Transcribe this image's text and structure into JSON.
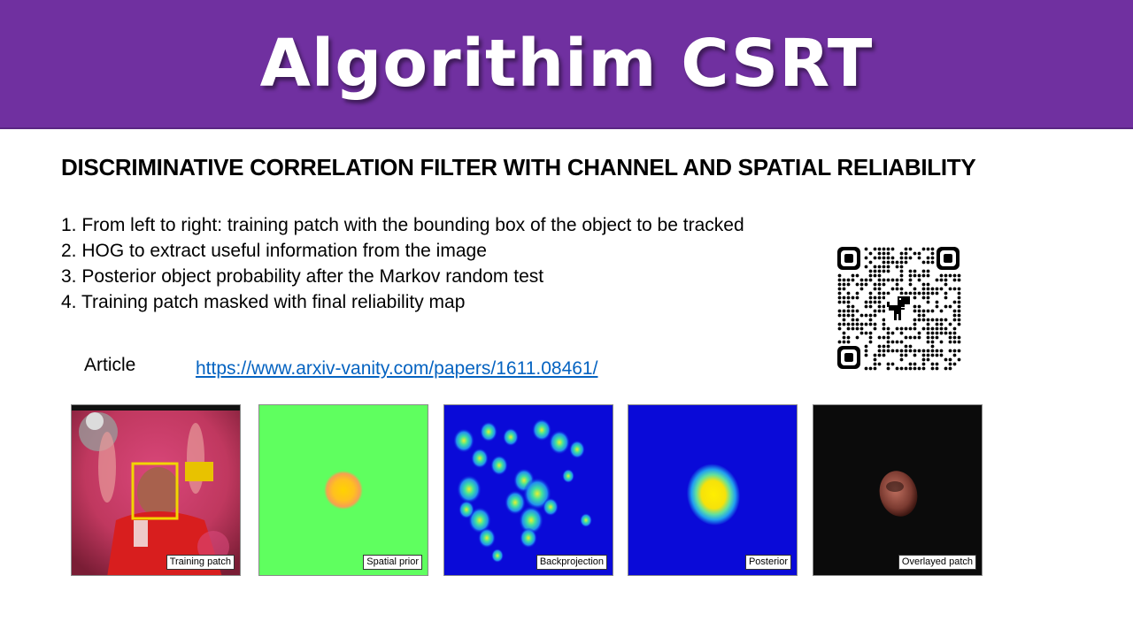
{
  "slide": {
    "title": "Algorithim CSRT",
    "subtitle": "DISCRIMINATIVE CORRELATION FILTER WITH CHANNEL AND SPATIAL RELIABILITY",
    "steps": [
      "1. From left to right: training patch with the bounding box of the object to be tracked",
      "2. HOG to extract useful information from the image",
      "3. Posterior object probability after the Markov random test",
      "4. Training patch masked with final reliability map"
    ],
    "article_label": "Article",
    "article_link": "https://www.arxiv-vanity.com/papers/1611.08461/"
  },
  "panels": [
    {
      "label": "Training patch"
    },
    {
      "label": "Spatial prior"
    },
    {
      "label": "Backprojection"
    },
    {
      "label": "Posterior"
    },
    {
      "label": "Overlayed patch"
    }
  ],
  "colors": {
    "banner": "#7030a0",
    "link": "#0563c1",
    "spatial_prior_bg": "#5fff5f",
    "heatmap_bg": "#0a0ad8",
    "bbox": "#f2d500"
  },
  "icons": {
    "qr": "qr-code-icon",
    "dino": "dinosaur-icon"
  }
}
